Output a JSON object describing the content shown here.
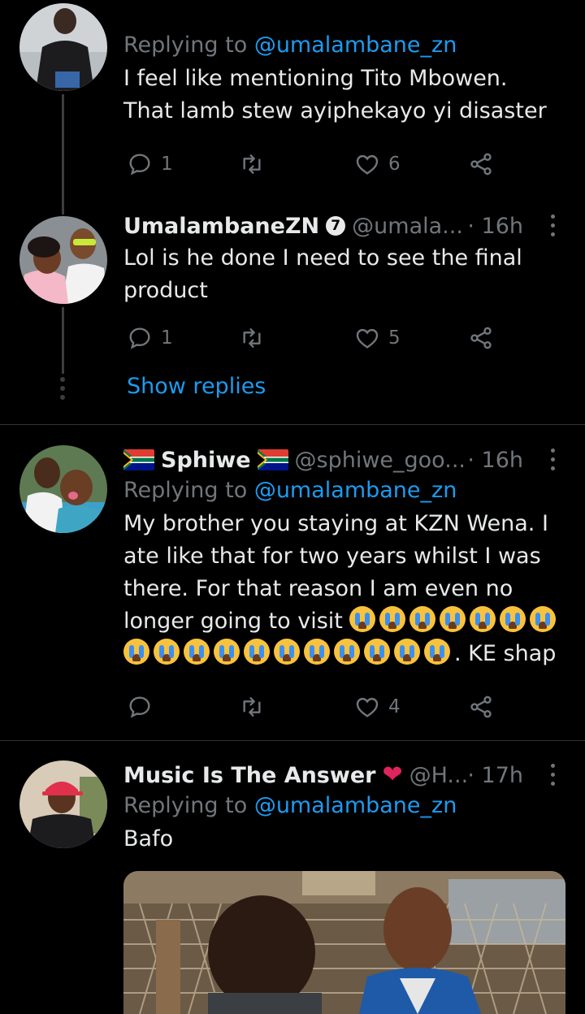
{
  "tweets": [
    {
      "reply_prefix": "Replying to",
      "reply_mention": "@umalambane_zn",
      "text": "I feel like mentioning Tito Mbowen. That lamb stew ayiphekayo yi disaster",
      "replies": "1",
      "retweets": "",
      "likes": "6"
    },
    {
      "name": "UmalambaneZN",
      "verified_mark": "7",
      "handle": "@umala...",
      "time": "· 16h",
      "text": "Lol is he done I need to see the final product",
      "replies": "1",
      "retweets": "",
      "likes": "5",
      "show_replies": "Show replies"
    },
    {
      "name": "Sphiwe",
      "handle": "@sphiwe_goo...",
      "time": "· 16h",
      "reply_prefix": "Replying to",
      "reply_mention": "@umalambane_zn",
      "text": "My brother you staying at KZN Wena. I ate like that for two years whilst I was there. For that reason I am even no longer going to visit",
      "text_tail": ". KE shap",
      "replies": "",
      "retweets": "",
      "likes": "4"
    },
    {
      "name": "Music Is The Answer",
      "handle": "@H...",
      "time": "· 17h",
      "reply_prefix": "Replying to",
      "reply_mention": "@umalambane_zn",
      "text": "Bafo"
    }
  ],
  "icons": {
    "reply": "reply-icon",
    "retweet": "retweet-icon",
    "like": "heart-icon",
    "share": "share-icon",
    "more": "more-icon",
    "emoji": "loudly-crying-face-emoji",
    "flag": "south-africa-flag"
  },
  "colors": {
    "background": "#000000",
    "text": "#e7e9ea",
    "muted": "#71767b",
    "link": "#1d9bf0",
    "divider": "#2f3336",
    "heart": "#e0245e"
  }
}
